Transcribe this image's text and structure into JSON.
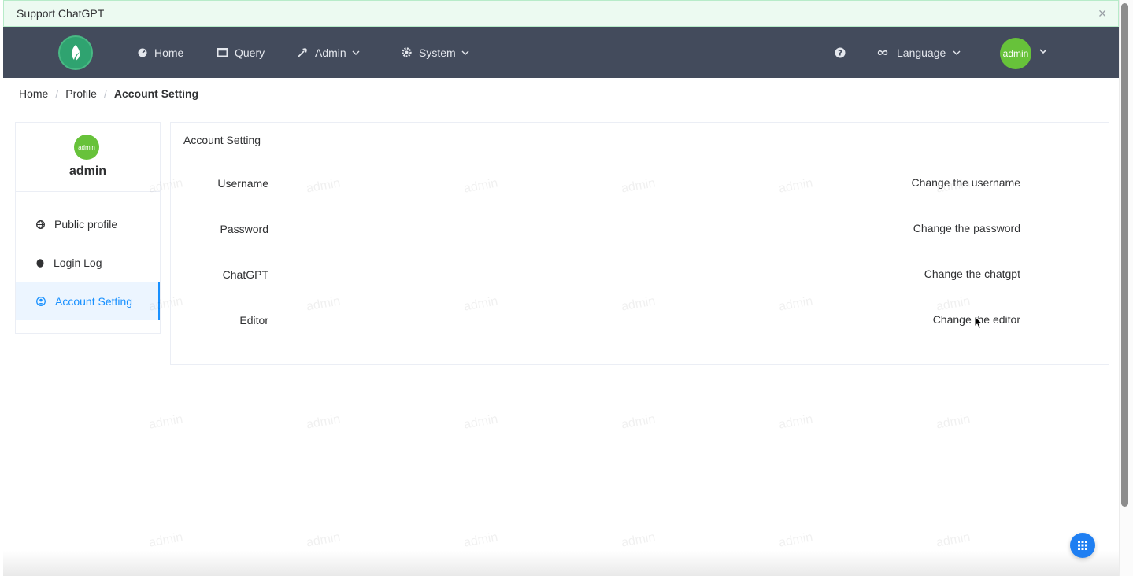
{
  "alert": {
    "text": "Support ChatGPT",
    "close_icon": "close-icon"
  },
  "navbar": {
    "logo_icon": "leaf-logo-icon",
    "items": [
      {
        "label": "Home",
        "icon": "dashboard-icon"
      },
      {
        "label": "Query",
        "icon": "window-icon"
      },
      {
        "label": "Admin",
        "icon": "hammer-icon",
        "has_dropdown": true
      },
      {
        "label": "System",
        "icon": "gear-icon",
        "has_dropdown": true
      }
    ],
    "help_icon": "question-circle-icon",
    "language": {
      "label": "Language",
      "icon": "infinity-icon"
    },
    "user_avatar": "admin"
  },
  "breadcrumb": {
    "items": [
      "Home",
      "Profile"
    ],
    "current": "Account Setting"
  },
  "profile_card": {
    "avatar_text": "admin",
    "name": "admin",
    "menu": [
      {
        "label": "Public profile",
        "icon": "globe-icon",
        "active": false
      },
      {
        "label": "Login Log",
        "icon": "egg-icon",
        "active": false
      },
      {
        "label": "Account Setting",
        "icon": "user-circle-icon",
        "active": true
      }
    ]
  },
  "settings_card": {
    "title": "Account Setting",
    "rows": [
      {
        "label": "Username",
        "action": "Change the username"
      },
      {
        "label": "Password",
        "action": "Change the password"
      },
      {
        "label": "ChatGPT",
        "action": "Change the chatgpt"
      },
      {
        "label": "Editor",
        "action": "Change the editor"
      }
    ]
  },
  "watermark": "admin",
  "colors": {
    "navbar": "#434b5c",
    "accent": "#1890ff",
    "avatar": "#67c23a",
    "alert_bg": "#ecfaf1",
    "fab": "#1f7ff2"
  }
}
